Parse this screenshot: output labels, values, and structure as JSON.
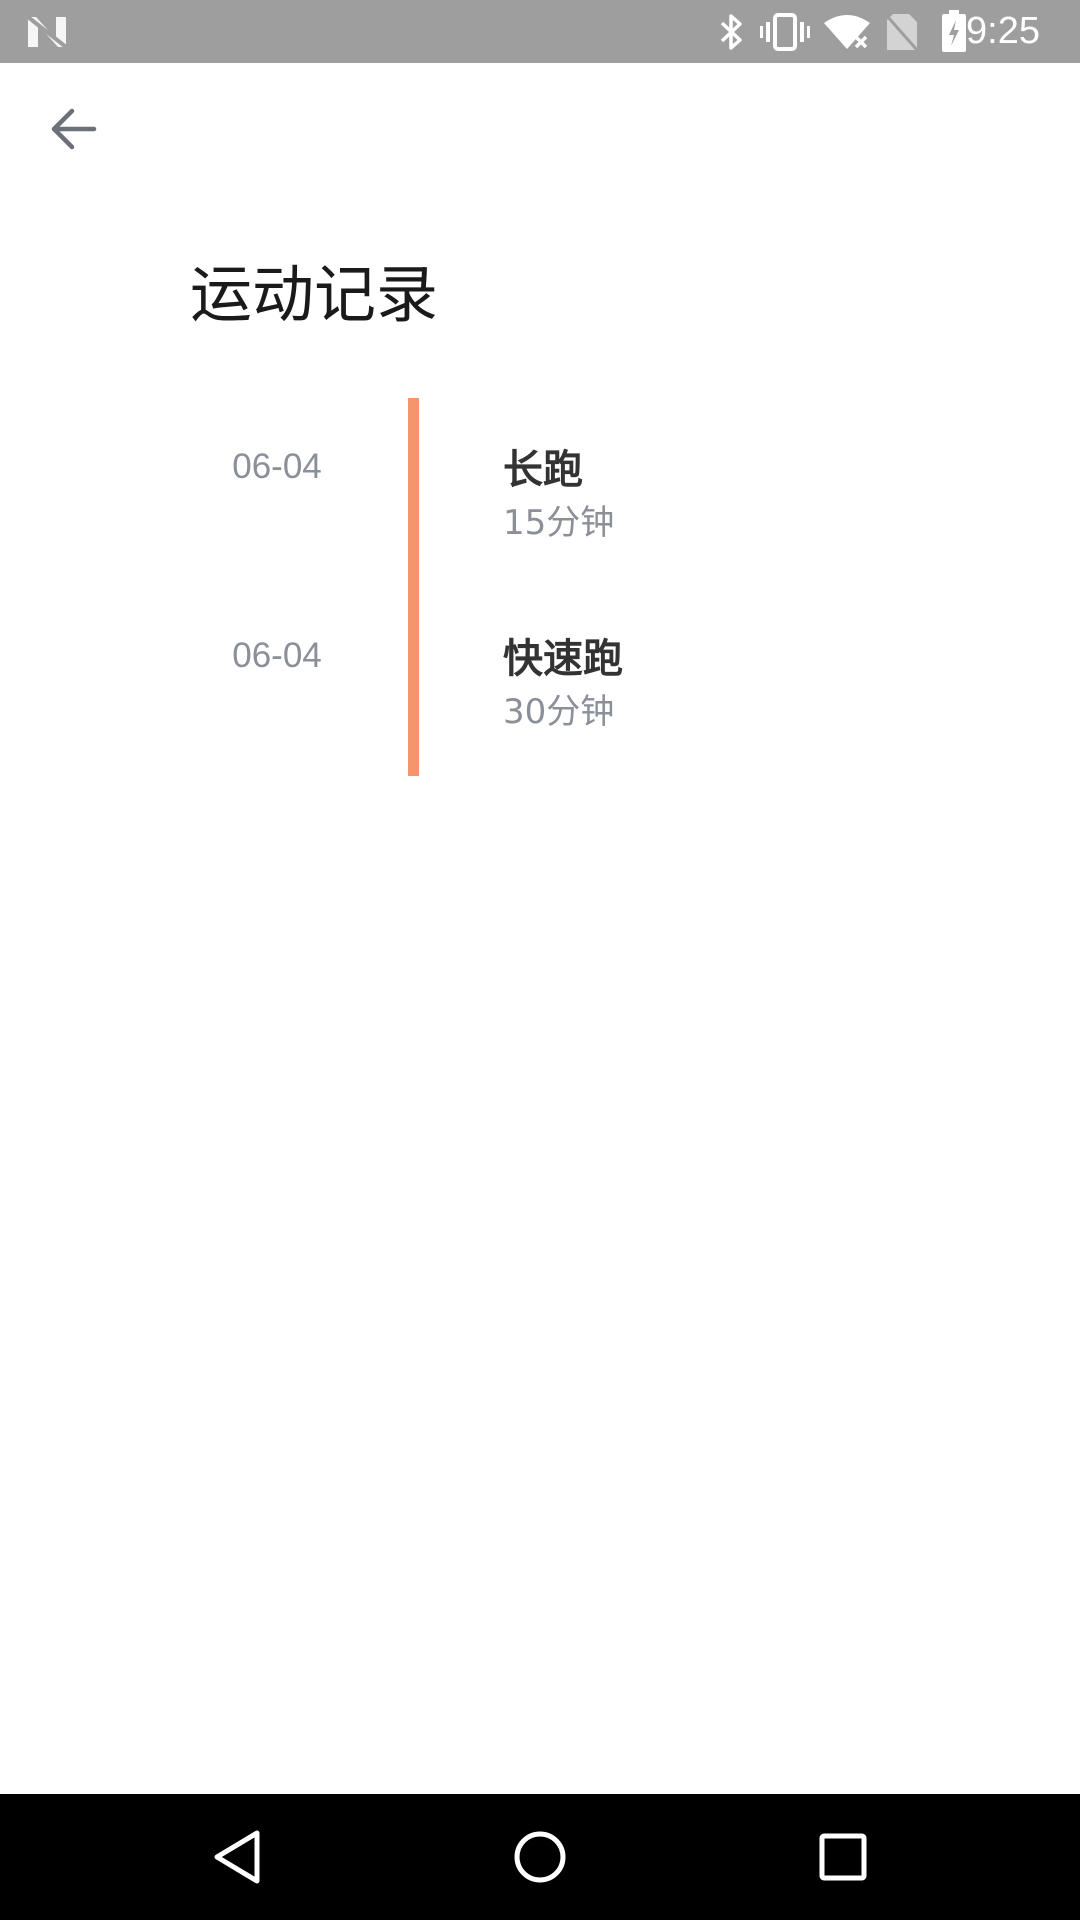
{
  "status_bar": {
    "time": "9:25",
    "icons": [
      "notification-n-icon",
      "bluetooth-icon",
      "vibrate-icon",
      "wifi-icon",
      "no-sim-icon",
      "battery-charging-icon"
    ]
  },
  "header": {
    "back_icon": "arrow-back-icon",
    "title": "运动记录"
  },
  "timeline": {
    "accent_color": "#f4956b",
    "records": [
      {
        "date": "06-04",
        "name": "长跑",
        "duration": "15分钟"
      },
      {
        "date": "06-04",
        "name": "快速跑",
        "duration": "30分钟"
      }
    ]
  },
  "nav_bar": {
    "buttons": [
      "back-triangle-icon",
      "home-circle-icon",
      "recents-square-icon"
    ]
  }
}
